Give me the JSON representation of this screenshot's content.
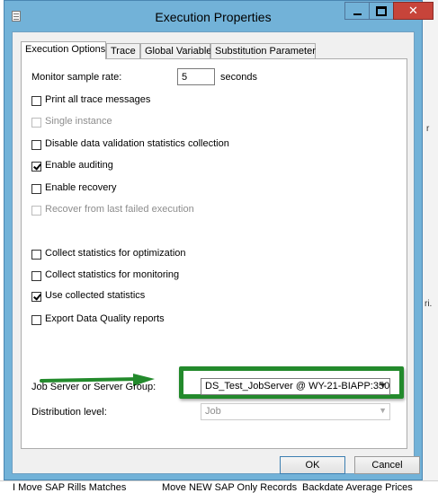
{
  "window": {
    "title": "Execution Properties",
    "close_glyph": "✕"
  },
  "tabs": [
    {
      "label": "Execution Options",
      "active": true
    },
    {
      "label": "Trace",
      "active": false
    },
    {
      "label": "Global Variable",
      "active": false
    },
    {
      "label": "Substitution Parameter",
      "active": false
    }
  ],
  "options": {
    "monitor_label": "Monitor sample rate:",
    "monitor_value": "5",
    "monitor_unit": "seconds",
    "checkboxes": [
      {
        "label": "Print all trace messages",
        "checked": false,
        "enabled": true
      },
      {
        "label": "Single instance",
        "checked": false,
        "enabled": false
      },
      {
        "label": "Disable data validation statistics collection",
        "checked": false,
        "enabled": true
      },
      {
        "label": "Enable auditing",
        "checked": true,
        "enabled": true
      },
      {
        "label": "Enable recovery",
        "checked": false,
        "enabled": true
      },
      {
        "label": "Recover from last failed execution",
        "checked": false,
        "enabled": false
      },
      {
        "label": "Collect statistics for optimization",
        "checked": false,
        "enabled": true
      },
      {
        "label": "Collect statistics for monitoring",
        "checked": false,
        "enabled": true
      },
      {
        "label": "Use collected statistics",
        "checked": true,
        "enabled": true
      },
      {
        "label": "Export Data Quality reports",
        "checked": false,
        "enabled": true
      }
    ],
    "job_server_label": "Job Server or Server Group:",
    "job_server_value": "DS_Test_JobServer @ WY-21-BIAPP:350:",
    "distribution_label": "Distribution level:",
    "distribution_value": "Job",
    "dropdown_glyph": "▼"
  },
  "buttons": {
    "ok": "OK",
    "cancel": "Cancel"
  },
  "background": {
    "bottom_items": [
      "I Move SAP Rills Matches",
      "Move NEW SAP Only Records",
      "Backdate Average Prices"
    ],
    "fragments": [
      "r",
      "ri."
    ]
  },
  "colors": {
    "title_bar": "#72b2d8",
    "close_button": "#c7443a",
    "annotation_green": "#238a2c"
  }
}
